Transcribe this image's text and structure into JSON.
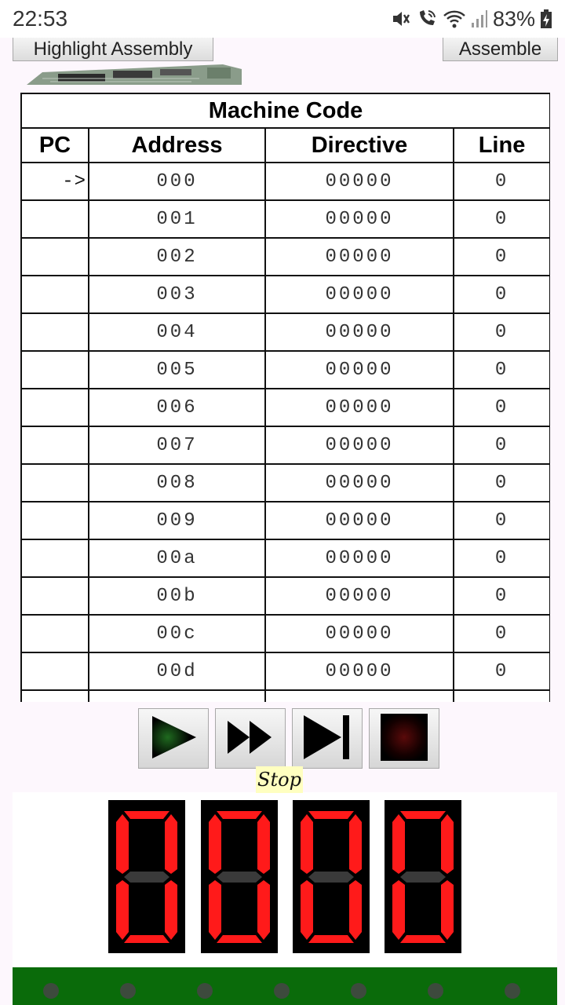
{
  "status_bar": {
    "time": "22:53",
    "battery": "83%",
    "icons": [
      "mute-icon",
      "wifi-call-icon",
      "wifi-icon",
      "signal-icon",
      "battery-charging-icon"
    ]
  },
  "toolbar": {
    "highlight_label": "Highlight Assembly",
    "assemble_label": "Assemble"
  },
  "table": {
    "caption": "Machine Code",
    "headers": [
      "PC",
      "Address",
      "Directive",
      "Line"
    ],
    "rows": [
      {
        "pc": "->",
        "address": "000",
        "directive": "00000",
        "line": "0"
      },
      {
        "pc": "",
        "address": "001",
        "directive": "00000",
        "line": "0"
      },
      {
        "pc": "",
        "address": "002",
        "directive": "00000",
        "line": "0"
      },
      {
        "pc": "",
        "address": "003",
        "directive": "00000",
        "line": "0"
      },
      {
        "pc": "",
        "address": "004",
        "directive": "00000",
        "line": "0"
      },
      {
        "pc": "",
        "address": "005",
        "directive": "00000",
        "line": "0"
      },
      {
        "pc": "",
        "address": "006",
        "directive": "00000",
        "line": "0"
      },
      {
        "pc": "",
        "address": "007",
        "directive": "00000",
        "line": "0"
      },
      {
        "pc": "",
        "address": "008",
        "directive": "00000",
        "line": "0"
      },
      {
        "pc": "",
        "address": "009",
        "directive": "00000",
        "line": "0"
      },
      {
        "pc": "",
        "address": "00a",
        "directive": "00000",
        "line": "0"
      },
      {
        "pc": "",
        "address": "00b",
        "directive": "00000",
        "line": "0"
      },
      {
        "pc": "",
        "address": "00c",
        "directive": "00000",
        "line": "0"
      },
      {
        "pc": "",
        "address": "00d",
        "directive": "00000",
        "line": "0"
      },
      {
        "pc": "",
        "address": "",
        "directive": "",
        "line": ""
      }
    ]
  },
  "controls": {
    "buttons": [
      "play-icon",
      "fast-forward-icon",
      "step-icon",
      "stop-icon"
    ],
    "tooltip": "Stop"
  },
  "display": {
    "digits": [
      "0",
      "0",
      "0",
      "0"
    ],
    "segment_on_color": "#ff1a1a",
    "segment_off_color": "#3a3a3a"
  },
  "board": {
    "color": "#0a6b0a",
    "led_count": 7
  }
}
